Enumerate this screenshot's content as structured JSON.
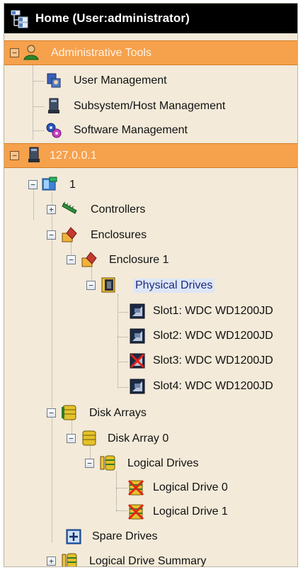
{
  "header": {
    "title": "Home (User:administrator)"
  },
  "admin_tools": {
    "label": "Administrative Tools",
    "items": [
      {
        "label": "User Management"
      },
      {
        "label": "Subsystem/Host Management"
      },
      {
        "label": "Software Management"
      }
    ]
  },
  "host": {
    "label": "127.0.0.1"
  },
  "tree": {
    "root": "1",
    "controllers": "Controllers",
    "enclosures": "Enclosures",
    "enclosure": "Enclosure 1",
    "physical_drives": "Physical Drives",
    "slots": [
      {
        "label": "Slot1: WDC WD1200JD",
        "status": "ok"
      },
      {
        "label": "Slot2: WDC WD1200JD",
        "status": "ok"
      },
      {
        "label": "Slot3: WDC WD1200JD",
        "status": "failed"
      },
      {
        "label": "Slot4: WDC WD1200JD",
        "status": "ok"
      }
    ],
    "disk_arrays": "Disk Arrays",
    "disk_array": "Disk Array 0",
    "logical_drives": "Logical Drives",
    "logical_drive_items": [
      {
        "label": "Logical Drive 0",
        "status": "failed"
      },
      {
        "label": "Logical Drive 1",
        "status": "failed"
      }
    ],
    "spare_drives": "Spare Drives",
    "logical_drive_summary": "Logical Drive Summary"
  },
  "colors": {
    "header_bg": "#000000",
    "orange_row": "#f6a14c",
    "panel_bg": "#f3ead9",
    "selection": "#dde6f7"
  }
}
